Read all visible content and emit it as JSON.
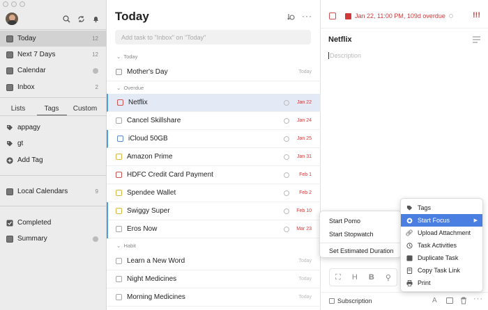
{
  "sidebar": {
    "nav": [
      {
        "label": "Today",
        "count": "12"
      },
      {
        "label": "Next 7 Days",
        "count": "12"
      },
      {
        "label": "Calendar",
        "count": ""
      },
      {
        "label": "Inbox",
        "count": "2"
      }
    ],
    "tabs": [
      "Lists",
      "Tags",
      "Custom"
    ],
    "tags": [
      {
        "label": "appagy"
      },
      {
        "label": "gt"
      }
    ],
    "add_tag": "Add Tag",
    "local_calendars": {
      "label": "Local Calendars",
      "count": "9"
    },
    "completed": "Completed",
    "summary": "Summary"
  },
  "list": {
    "title": "Today",
    "add_placeholder": "Add task to \"Inbox\" on \"Today\"",
    "sections": {
      "today": "Today",
      "overdue": "Overdue",
      "habit": "Habit"
    },
    "today_tasks": [
      {
        "title": "Mother's Day",
        "date": "Today"
      }
    ],
    "overdue_tasks": [
      {
        "title": "Netflix",
        "date": "Jan 22"
      },
      {
        "title": "Cancel Skillshare",
        "date": "Jan 24"
      },
      {
        "title": "iCloud 50GB",
        "date": "Jan 25"
      },
      {
        "title": "Amazon Prime",
        "date": "Jan 31"
      },
      {
        "title": "HDFC Credit Card Payment",
        "date": "Feb 1"
      },
      {
        "title": "Spendee Wallet",
        "date": "Feb 2"
      },
      {
        "title": "Swiggy Super",
        "date": "Feb 10"
      },
      {
        "title": "Eros Now",
        "date": "Mar 23"
      }
    ],
    "habit_tasks": [
      {
        "title": "Learn a New Word",
        "date": "Today"
      },
      {
        "title": "Night Medicines",
        "date": "Today"
      },
      {
        "title": "Morning Medicines",
        "date": "Today"
      }
    ]
  },
  "detail": {
    "due": "Jan 22, 11:00 PM, 109d overdue",
    "priority": "!!!",
    "title": "Netflix",
    "description_placeholder": "Description",
    "list_name": "Subscription"
  },
  "context_menu": {
    "items": [
      "Tags",
      "Start Focus",
      "Upload Attachment",
      "Task Activities",
      "Duplicate Task",
      "Copy Task Link",
      "Print"
    ],
    "highlighted": "Start Focus"
  },
  "submenu": {
    "items": [
      "Start Pomo",
      "Start Stopwatch",
      "Set Estimated Duration"
    ]
  },
  "colors": {
    "accent": "#4a7ee0",
    "overdue": "#d03a3a",
    "sidebar_bg": "#ececec",
    "selected_row": "#e4e9f6"
  }
}
